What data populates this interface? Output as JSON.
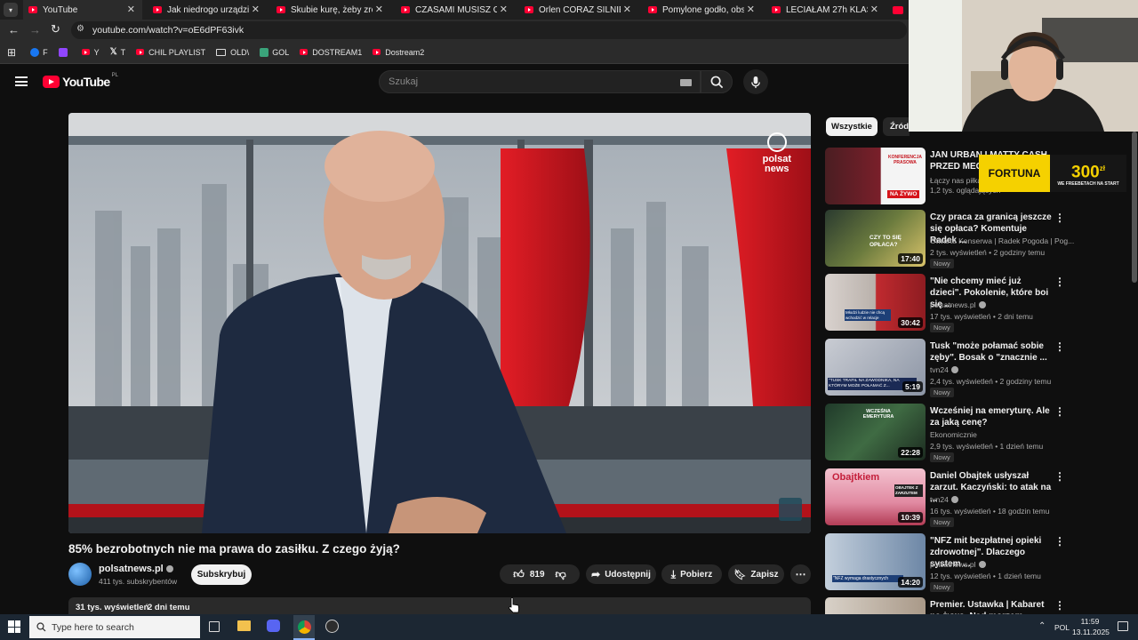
{
  "browser": {
    "tabs": [
      {
        "label": "YouTube",
        "active": true
      },
      {
        "label": "Jak niedrogo urządzić sy"
      },
      {
        "label": "Skubie kurę, żeby zrobić"
      },
      {
        "label": "CZASAMI MUSISZ ODPUS"
      },
      {
        "label": "Orlen CORAZ SILNIEJSZY"
      },
      {
        "label": "Pomylone godło, obsydia"
      },
      {
        "label": "LECIAŁAM 27h KLASĄ BIZ"
      }
    ],
    "url": "youtube.com/watch?v=oE6dPF63ivk",
    "bookmarks": [
      {
        "label": "F",
        "icon": "facebook-icon"
      },
      {
        "label": "",
        "icon": "twitch-icon"
      },
      {
        "label": "Y",
        "icon": "youtube-icon"
      },
      {
        "label": "T",
        "icon": "x-icon"
      },
      {
        "label": "CHIL PLAYLIST",
        "icon": "youtube-icon"
      },
      {
        "label": "OLD\\",
        "icon": "folder-icon"
      },
      {
        "label": "GOL",
        "icon": "gol-icon"
      },
      {
        "label": "DOSTREAM1",
        "icon": "youtube-icon"
      },
      {
        "label": "Dostream2",
        "icon": "youtube-icon"
      }
    ]
  },
  "youtube": {
    "logo_text": "YouTube",
    "logo_region": "PL",
    "search_placeholder": "Szukaj",
    "player": {
      "watermark_line1": "polsat",
      "watermark_line2": "news"
    },
    "video": {
      "title": "85% bezrobotnych nie ma prawa do zasiłku. Z czego żyją?",
      "channel": "polsatnews.pl",
      "subscribers": "411 tys. subskrybentów",
      "subscribe_label": "Subskrybuj",
      "likes": "819",
      "share_label": "Udostępnij",
      "download_label": "Pobierz",
      "save_label": "Zapisz",
      "views": "31 tys. wyświetleń",
      "date": "2 dni temu"
    },
    "chips": [
      "Wszystkie",
      "Źródł"
    ],
    "recommendations": [
      {
        "title": "JAN URBAN I MATTY CASH PRZED MECZ...",
        "channel": "Łączy nas piłka",
        "meta": "1,2 tys. oglądających",
        "duration": "",
        "badge": "",
        "thumb_text": "NA ŻYWO",
        "thumb_caption": "KONFERENCJA PRASOWA"
      },
      {
        "title": "Czy praca za granicą jeszcze się opłaca? Komentuje Radek ...",
        "channel": "Otwarta Konserwa | Radek Pogoda | Pog...",
        "meta": "2 tys. wyświetleń • 2 godziny temu",
        "duration": "17:40",
        "badge": "Nowy",
        "thumb_text": "CZY TO SIĘ OPŁACA?"
      },
      {
        "title": "\"Nie chcemy mieć już dzieci\". Pokolenie, które boi się ...",
        "channel": "polsatnews.pl",
        "meta": "17 tys. wyświetleń • 2 dni temu",
        "duration": "30:42",
        "badge": "Nowy",
        "thumb_text": "Młodzi ludzie nie chcą wchodzić w relacje"
      },
      {
        "title": "Tusk \"może połamać sobie zęby\". Bosak o \"znacznie ...",
        "channel": "tvn24",
        "meta": "2,4 tys. wyświetleń • 2 godziny temu",
        "duration": "5:19",
        "badge": "Nowy",
        "thumb_text": "\"TUSK TRAFIŁ NA ZAWODNIKA, NA KTÓRYM MOŻE POŁAMAĆ Z..."
      },
      {
        "title": "Wcześniej na emeryturę. Ale za jaką cenę?",
        "channel": "Ekonomicznie",
        "meta": "2,9 tys. wyświetleń • 1 dzień temu",
        "duration": "22:28",
        "badge": "Nowy",
        "thumb_text": "WCZEŚNA EMERYTURA"
      },
      {
        "title": "Daniel Obajtek usłyszał zarzut. Kaczyński: to atak na ...",
        "channel": "tvn24",
        "meta": "16 tys. wyświetleń • 18 godzin temu",
        "duration": "10:39",
        "badge": "Nowy",
        "thumb_text": "Obajtkiem",
        "thumb_caption": "OBAJTEK Z ZARZUTEM"
      },
      {
        "title": "\"NFZ mit bezpłatnej opieki zdrowotnej\". Dlaczego system ...",
        "channel": "polsatnews.pl",
        "meta": "12 tys. wyświetleń • 1 dzień temu",
        "duration": "14:20",
        "badge": "Nowy",
        "thumb_text": "\"NFZ wymaga drastycznych"
      },
      {
        "title": "Premier. Ustawka | Kabaret na żywo. Nad morzem rzeka...",
        "channel": "",
        "meta": "",
        "duration": "",
        "badge": "",
        "thumb_text": ""
      }
    ]
  },
  "overlay": {
    "fortuna_brand": "FORTUNA",
    "fortuna_amount": "300",
    "fortuna_currency": "zł",
    "fortuna_sub": "WE FREEBETACH NA START"
  },
  "taskbar": {
    "search_placeholder": "Type here to search",
    "language": "POL",
    "time": "11:59",
    "date": "13.11.2025"
  },
  "colors": {
    "yt_red": "#ff0033",
    "bg": "#0f0f0f",
    "fortuna_yellow": "#f5d100"
  }
}
